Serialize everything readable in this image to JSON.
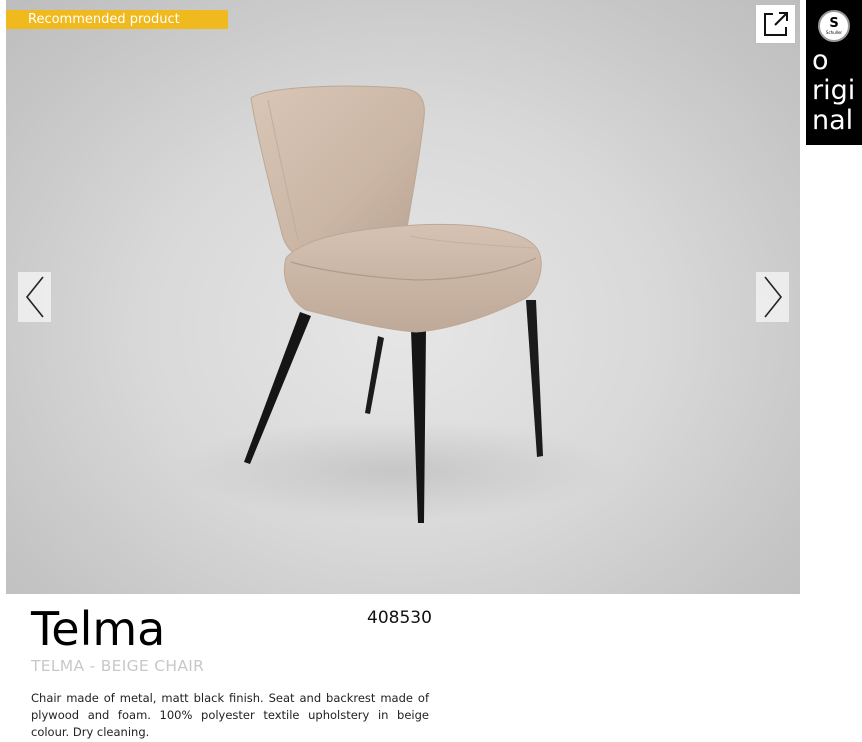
{
  "badge": {
    "label": "Recommended product"
  },
  "gallery": {
    "prev_icon": "chevron-left-icon",
    "next_icon": "chevron-right-icon",
    "external_icon": "external-link-icon"
  },
  "logo": {
    "brand_small": "Schuller",
    "letter": "S",
    "word_lines": [
      "o",
      "rigi",
      "nal"
    ]
  },
  "product": {
    "name": "Telma",
    "code": "408530",
    "subtitle": "TELMA - BEIGE CHAIR",
    "description": "Chair made of metal, matt black finish. Seat and backrest made of plywood and foam. 100% polyester textile upholstery in beige colour. Dry cleaning."
  },
  "colors": {
    "badge": "#f0b91d",
    "upholstery": "#cdb8a8",
    "legs": "#1a1a1a"
  }
}
